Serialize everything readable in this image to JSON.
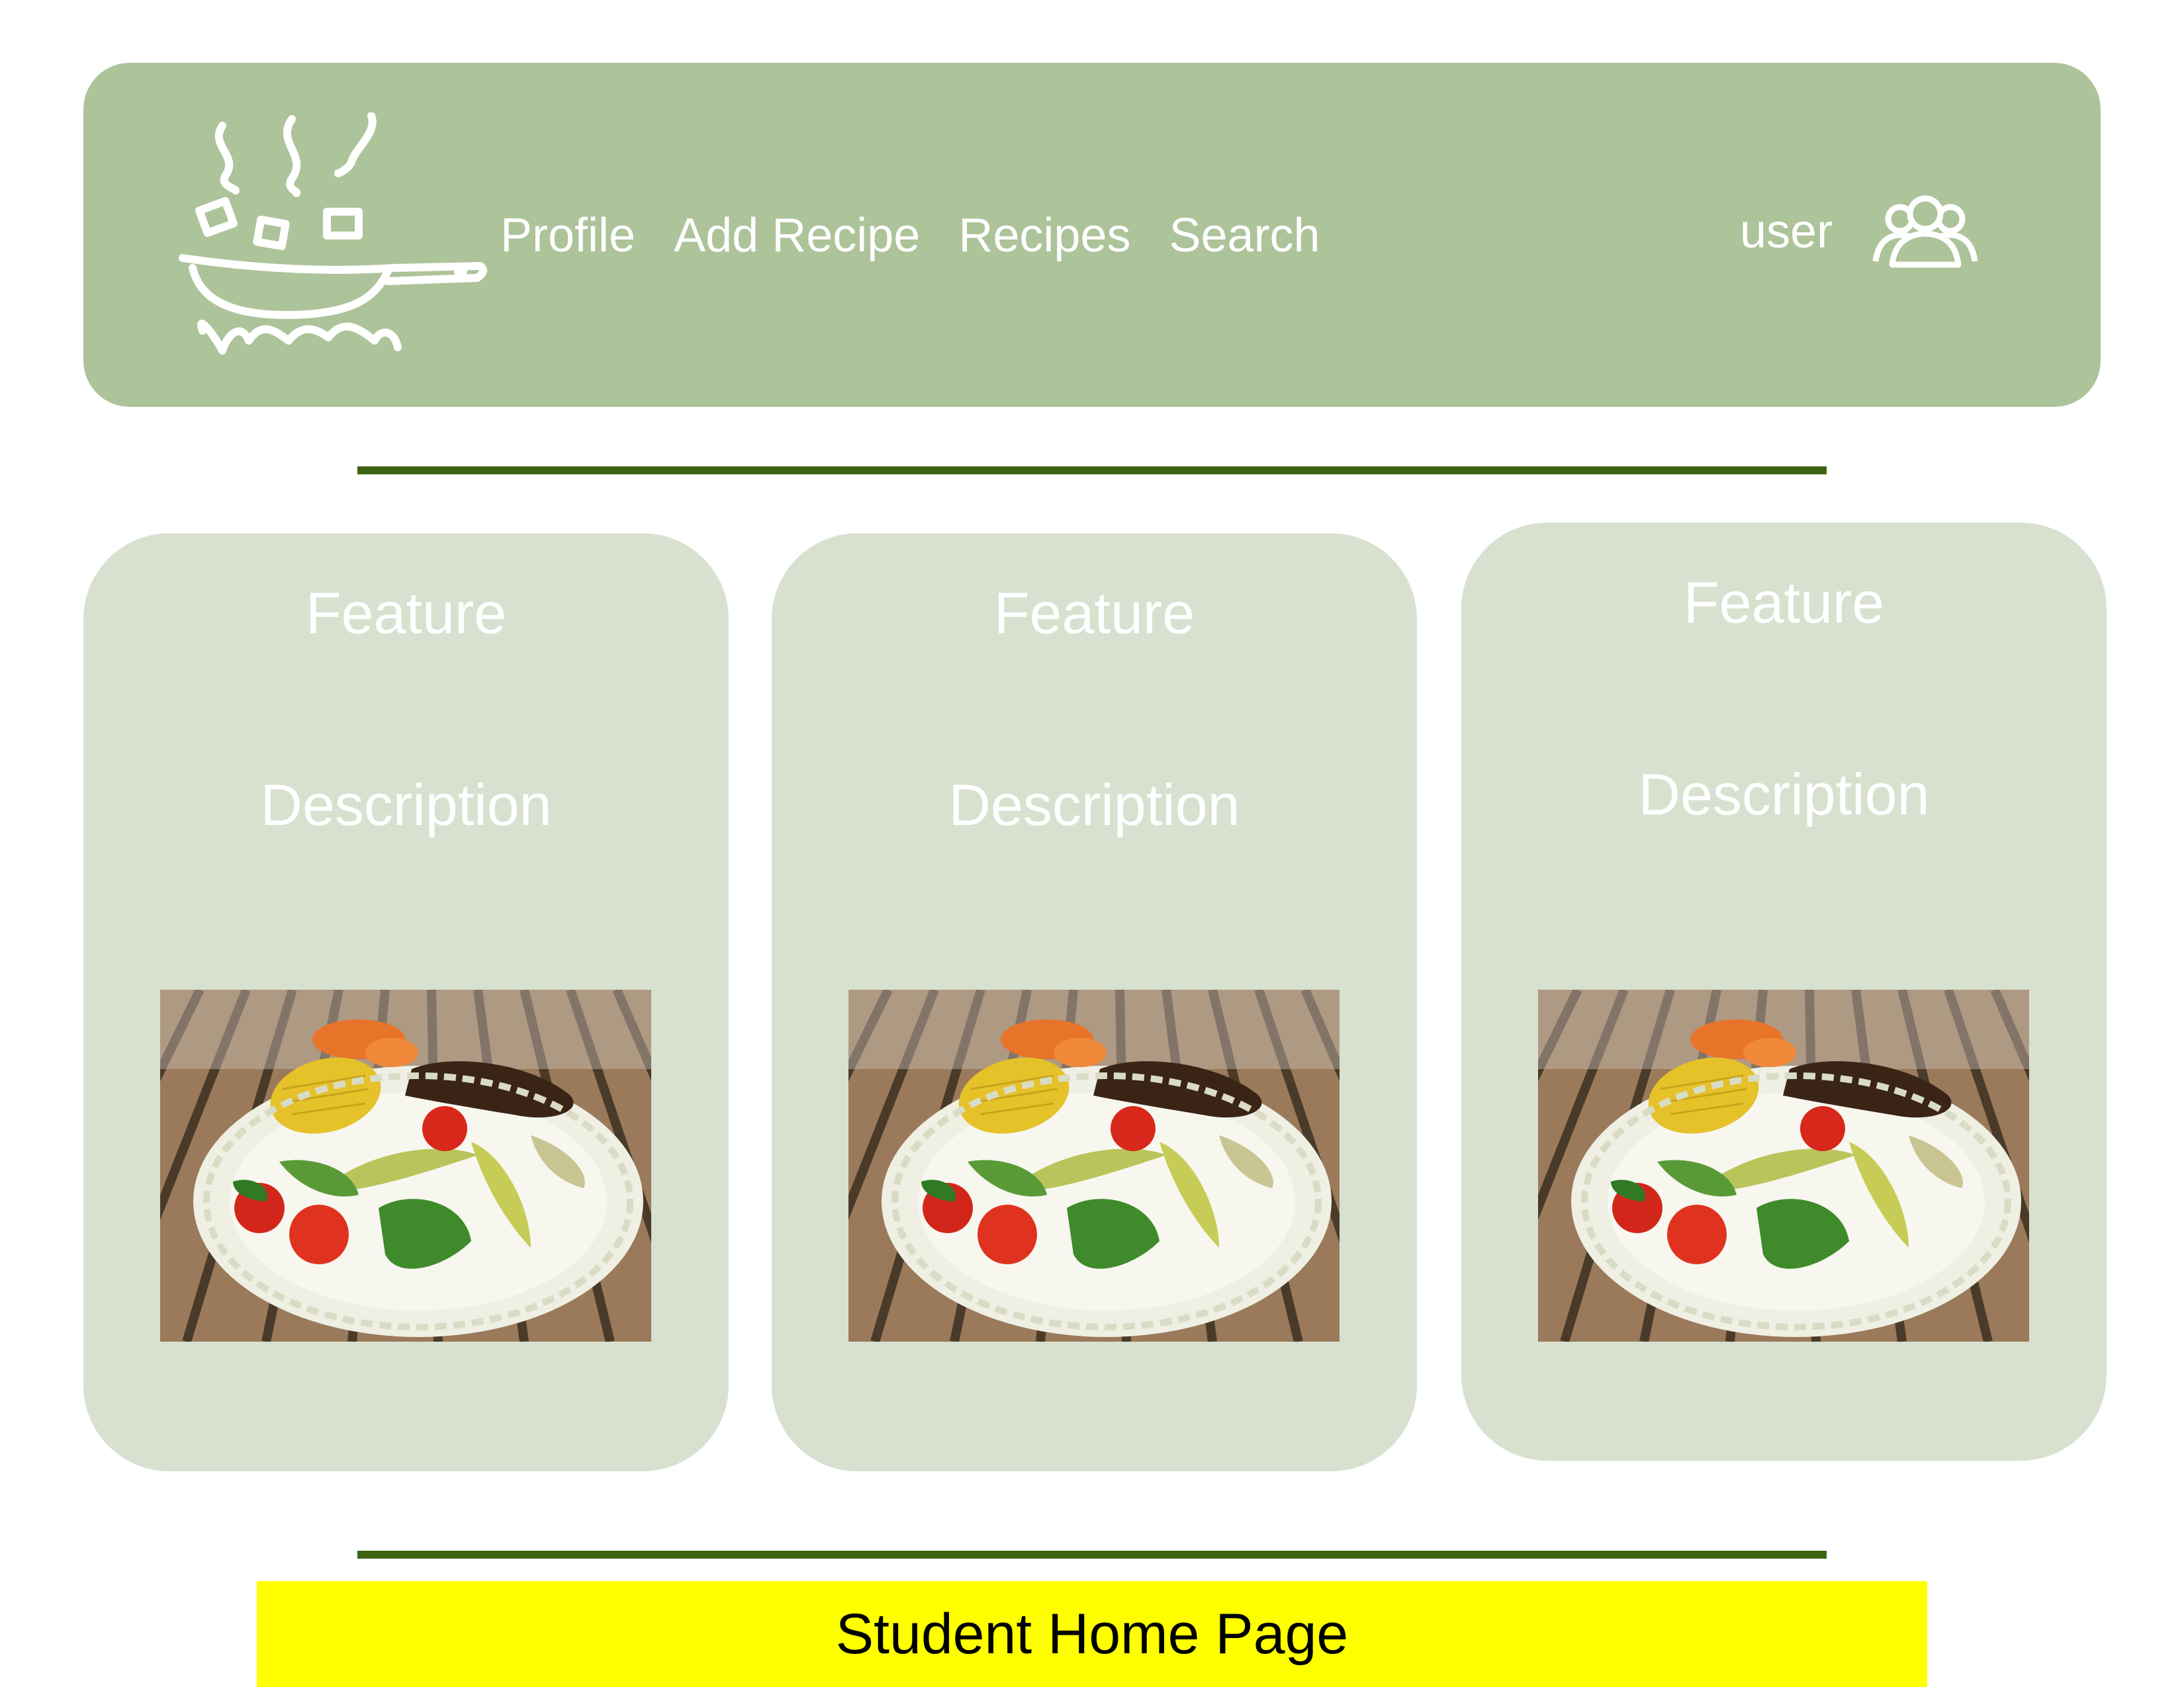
{
  "header": {
    "nav": [
      "Profile",
      "Add Recipe",
      "Recipes",
      "Search"
    ],
    "user_label": "user"
  },
  "cards": [
    {
      "title": "Feature",
      "description": "Description"
    },
    {
      "title": "Feature",
      "description": "Description"
    },
    {
      "title": "Feature",
      "description": "Description"
    }
  ],
  "footer": {
    "label": "Student Home Page"
  },
  "icons": {
    "logo": "cooking-pan-logo-icon",
    "user": "users-group-icon"
  },
  "colors": {
    "header_bg": "#adc39a",
    "card_bg": "#d8e1d0",
    "divider": "#3d6410",
    "footer_bg": "#ffff00"
  }
}
